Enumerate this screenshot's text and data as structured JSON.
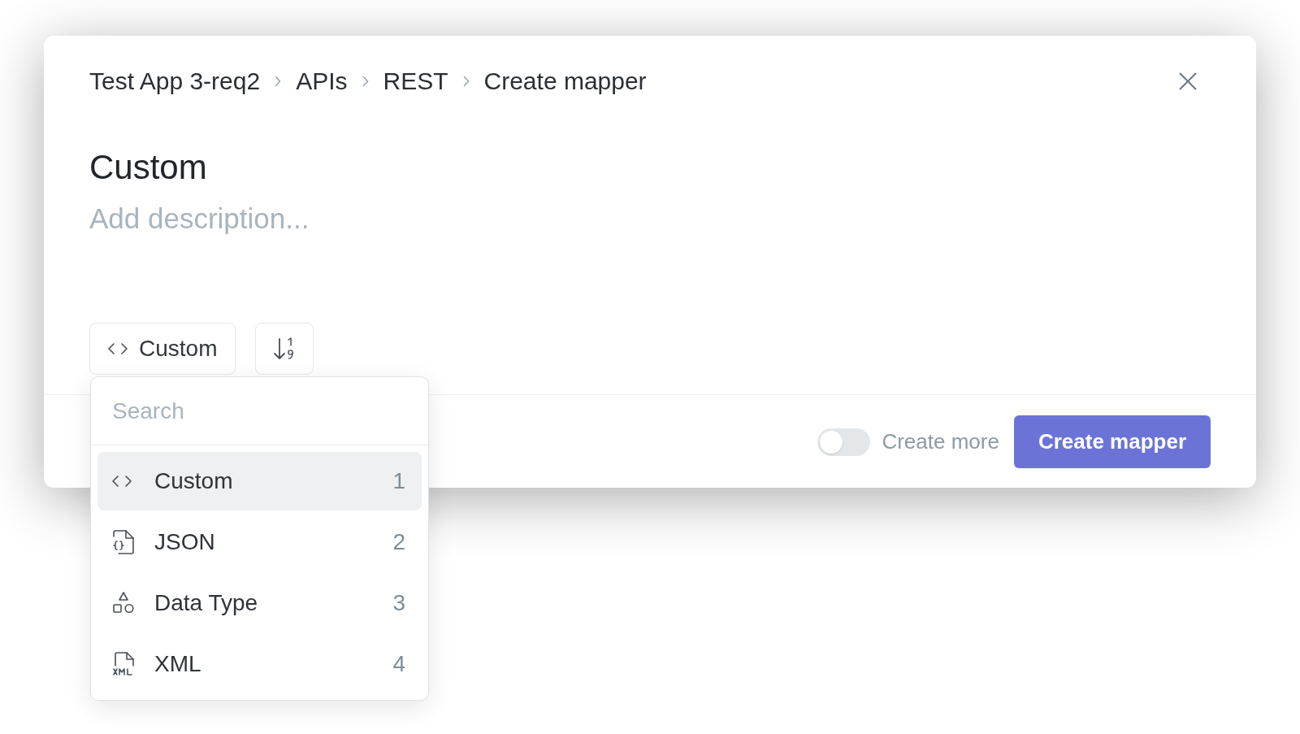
{
  "breadcrumb": [
    "Test App 3-req2",
    "APIs",
    "REST",
    "Create mapper"
  ],
  "title": "Custom",
  "description": {
    "placeholder": "Add description..."
  },
  "type_button": {
    "kind": "code",
    "label": "Custom"
  },
  "menu": {
    "search": {
      "placeholder": "Search"
    },
    "items": [
      {
        "kind": "code",
        "label": "Custom",
        "shortcut": "1",
        "selected": true
      },
      {
        "kind": "json",
        "label": "JSON",
        "shortcut": "2",
        "selected": false
      },
      {
        "kind": "datatype",
        "label": "Data Type",
        "shortcut": "3",
        "selected": false
      },
      {
        "kind": "xml",
        "label": "XML",
        "shortcut": "4",
        "selected": false
      }
    ]
  },
  "footer": {
    "create_more": {
      "label": "Create more",
      "on": false
    },
    "submit": {
      "label": "Create mapper"
    }
  }
}
